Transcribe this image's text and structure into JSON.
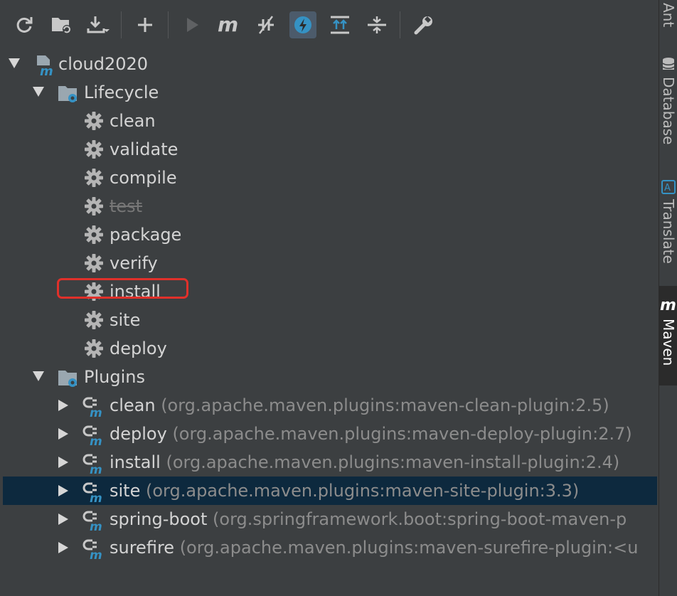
{
  "toolbar": {
    "buttons": [
      {
        "name": "reload-all-icon",
        "active": false
      },
      {
        "name": "add-maven-project-icon",
        "active": false
      },
      {
        "name": "download-sources-icon",
        "active": false
      },
      {
        "name": "add-icon",
        "active": false
      },
      {
        "name": "run-icon",
        "active": false
      },
      {
        "name": "execute-maven-goal-icon",
        "active": false
      },
      {
        "name": "toggle-offline-icon",
        "active": false
      },
      {
        "name": "skip-tests-icon",
        "active": true
      },
      {
        "name": "show-dependencies-icon",
        "active": false
      },
      {
        "name": "collapse-all-icon",
        "active": false
      },
      {
        "name": "settings-wrench-icon",
        "active": false
      }
    ],
    "accent": "#3592c4"
  },
  "tree": {
    "project": "cloud2020",
    "lifecycle_label": "Lifecycle",
    "lifecycle": [
      {
        "label": "clean",
        "disabled": false
      },
      {
        "label": "validate",
        "disabled": false
      },
      {
        "label": "compile",
        "disabled": false
      },
      {
        "label": "test",
        "disabled": true
      },
      {
        "label": "package",
        "disabled": false
      },
      {
        "label": "verify",
        "disabled": false
      },
      {
        "label": "install",
        "disabled": false,
        "highlighted": true
      },
      {
        "label": "site",
        "disabled": false
      },
      {
        "label": "deploy",
        "disabled": false
      }
    ],
    "plugins_label": "Plugins",
    "plugins": [
      {
        "label": "clean",
        "coord": "(org.apache.maven.plugins:maven-clean-plugin:2.5)",
        "selected": false
      },
      {
        "label": "deploy",
        "coord": "(org.apache.maven.plugins:maven-deploy-plugin:2.7)",
        "selected": false
      },
      {
        "label": "install",
        "coord": "(org.apache.maven.plugins:maven-install-plugin:2.4)",
        "selected": false
      },
      {
        "label": "site",
        "coord": "(org.apache.maven.plugins:maven-site-plugin:3.3)",
        "selected": true
      },
      {
        "label": "spring-boot",
        "coord": "(org.springframework.boot:spring-boot-maven-p",
        "selected": false
      },
      {
        "label": "surefire",
        "coord": "(org.apache.maven.plugins:maven-surefire-plugin:<u",
        "selected": false
      }
    ]
  },
  "sidebar": {
    "tabs": [
      {
        "label": "Ant",
        "icon": "ant-icon",
        "active": false
      },
      {
        "label": "Database",
        "icon": "database-icon",
        "active": false
      },
      {
        "label": "Translate",
        "icon": "translate-icon",
        "active": false
      },
      {
        "label": "Maven",
        "icon": "maven-icon",
        "active": true
      }
    ]
  }
}
